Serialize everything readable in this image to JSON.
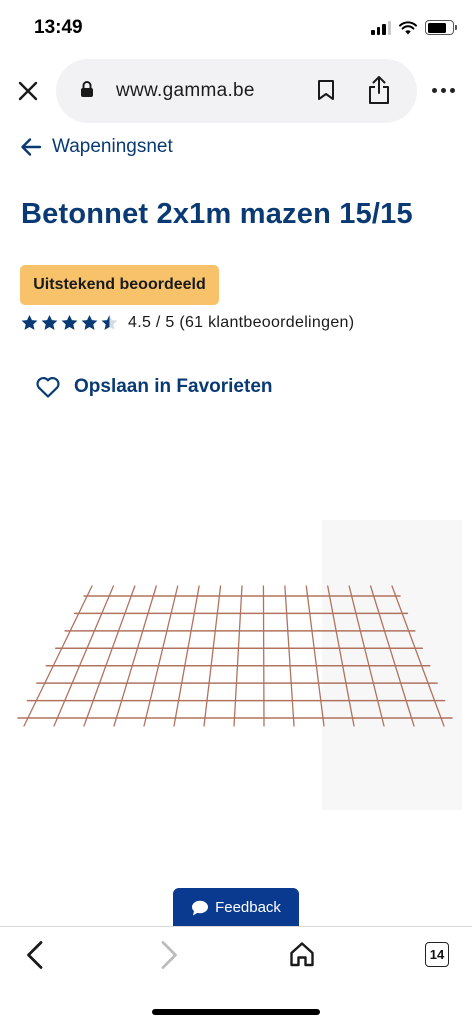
{
  "status_bar": {
    "time": "13:49"
  },
  "browser": {
    "url": "www.gamma.be",
    "tab_count": "14"
  },
  "breadcrumb": {
    "label": "Wapeningsnet"
  },
  "product": {
    "title": "Betonnet 2x1m mazen 15/15",
    "badge": "Uitstekend beoordeeld",
    "rating_value": 4.5,
    "rating_max": 5,
    "rating_text": "4.5 / 5 (61 klantbeoordelingen)",
    "favorite_label": "Opslaan in Favorieten"
  },
  "feedback": {
    "label": "Feedback"
  },
  "colors": {
    "brand_blue": "#0a3a73",
    "badge_orange": "#f8c26b",
    "feedback_blue": "#0a3a8f",
    "mesh_rust": "#b0735f"
  },
  "icons": {
    "close": "close-icon",
    "lock": "lock-icon",
    "bookmark": "bookmark-icon",
    "share": "share-icon",
    "more": "more-icon",
    "back_arrow": "arrow-left-icon",
    "heart": "heart-icon",
    "star": "star-icon",
    "chat": "chat-bubble-icon",
    "home": "home-icon",
    "tabs": "tabs-icon"
  }
}
